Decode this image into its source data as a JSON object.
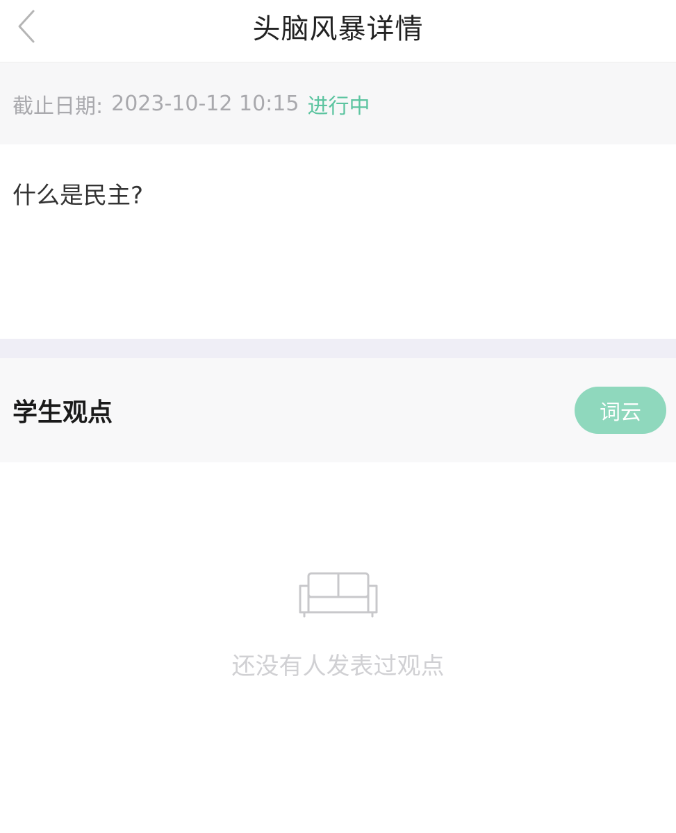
{
  "nav": {
    "title": "头脑风暴详情",
    "back_icon": "chevron-left-icon"
  },
  "deadline": {
    "label": "截止日期:",
    "value": "2023-10-12 10:15",
    "status": "进行中"
  },
  "question": {
    "text": "什么是民主?"
  },
  "opinions": {
    "title": "学生观点",
    "wordcloud_label": "词云"
  },
  "empty_state": {
    "icon": "sofa-icon",
    "text": "还没有人发表过观点"
  },
  "colors": {
    "accent": "#5cc4a0",
    "button_bg": "#8fd8bd",
    "muted_text": "#a9a9ad"
  }
}
